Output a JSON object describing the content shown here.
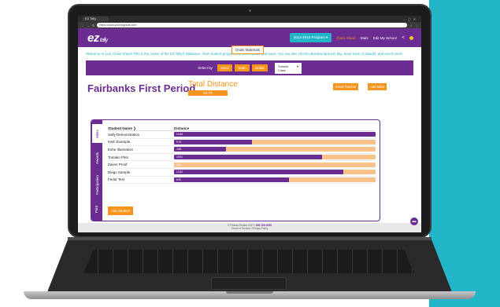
{
  "browser": {
    "tab_title": "EZ Tally",
    "url": "https://www.yourezgrade.com"
  },
  "header": {
    "logo_mark": "ez",
    "logo_text": "tally",
    "program_button": "2014-2015 Program ▾",
    "nav": [
      "Class Sheet",
      "Stats",
      "Edit My School"
    ],
    "active_nav": "Class Sheet",
    "dropdown_item": "Order Materials"
  },
  "welcome": {
    "text_lead": "Welcome to your Class Sheet! This is the center of the EZ Tally® database. View student progress by class, grade and team. You can also check individual laps per day, keep track of awards, and much more!"
  },
  "select_bar": {
    "label": "Select by",
    "options": [
      "Class",
      "Team",
      "Grade"
    ],
    "dropdown_value": "Sample Class",
    "dropdown_arrow": "▾"
  },
  "page": {
    "title": "Fairbanks First Period",
    "total_distance_label": "Total Distance",
    "total_distance_value": "54.75",
    "email_button": "Email Teacher",
    "add_miles_button": "Add Miles"
  },
  "vertical_tabs": [
    "Miles",
    "Awards",
    "Participation",
    "Print"
  ],
  "table": {
    "headers": [
      "Student Name ❯",
      "Distance"
    ],
    "max_distance": 14.88,
    "rows": [
      {
        "name": "Sally Demonstration",
        "distance": 14.88,
        "label": "14.88"
      },
      {
        "name": "Irwin Example",
        "distance": 5.75,
        "label": "5.75"
      },
      {
        "name": "Eshe Illustration",
        "distance": 3.85,
        "label": "3.85"
      },
      {
        "name": "Tomako Pilot",
        "distance": 10.91,
        "label": "10.91"
      },
      {
        "name": "Zavier Proof",
        "distance": 0.0,
        "label": "0.00"
      },
      {
        "name": "Diego Sample",
        "distance": 12.52,
        "label": "12.52"
      },
      {
        "name": "Fedor Test",
        "distance": 8.51,
        "label": "8.51"
      }
    ],
    "add_button": "Add Student"
  },
  "footer": {
    "line1_prefix": "© Fitness Finders 2017 • ",
    "phone": "800-789-9255",
    "line2": "Terms of Service • Privacy Policy"
  },
  "colors": {
    "purple": "#6b2d91",
    "orange": "#f7941d",
    "teal": "#22b6c8",
    "bar_bg": "#f9c28a"
  }
}
